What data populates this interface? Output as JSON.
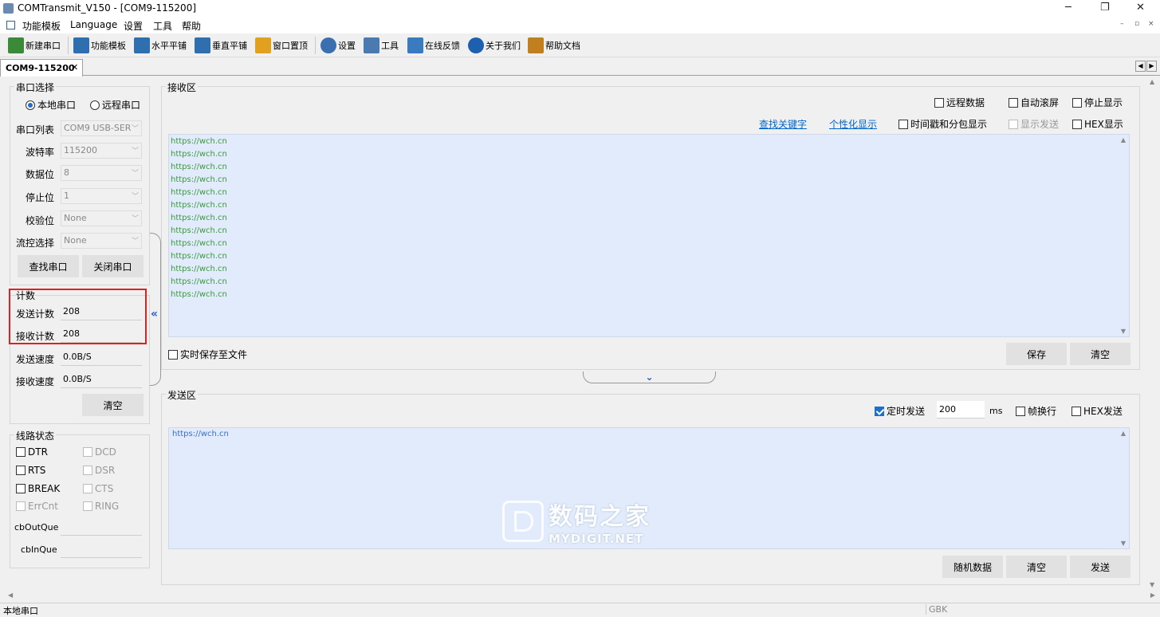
{
  "window": {
    "title": "COMTransmit_V150 - [COM9-115200]",
    "minimize": "─",
    "maximize": "❐",
    "close": "✕"
  },
  "menu": {
    "items": [
      "功能模板",
      "Language",
      "设置",
      "工具",
      "帮助"
    ]
  },
  "toolbar": {
    "buttons": [
      {
        "label": "新建串口",
        "icon": "new-port-icon",
        "color": "#3a8a3a"
      },
      {
        "label": "功能模板",
        "icon": "template-icon",
        "color": "#2f6fb0"
      },
      {
        "label": "水平平铺",
        "icon": "tile-horizontal-icon",
        "color": "#2f6fb0"
      },
      {
        "label": "垂直平铺",
        "icon": "tile-vertical-icon",
        "color": "#2f6fb0"
      },
      {
        "label": "窗口置顶",
        "icon": "pin-window-icon",
        "color": "#e0a020"
      },
      {
        "label": "设置",
        "icon": "gear-icon",
        "color": "#3a6fb0"
      },
      {
        "label": "工具",
        "icon": "tools-icon",
        "color": "#4a7ab0"
      },
      {
        "label": "在线反馈",
        "icon": "feedback-icon",
        "color": "#3a7ac0"
      },
      {
        "label": "关于我们",
        "icon": "info-icon",
        "color": "#1e5fb0"
      },
      {
        "label": "帮助文档",
        "icon": "help-doc-icon",
        "color": "#c08020"
      }
    ]
  },
  "tab": {
    "label": "COM9-115200",
    "close": "✕"
  },
  "port": {
    "section": "串口选择",
    "local": "本地串口",
    "remote": "远程串口",
    "list_label": "串口列表",
    "list_value": "COM9   USB-SER",
    "baud_label": "波特率",
    "baud_value": "115200",
    "data_label": "数据位",
    "data_value": "8",
    "stop_label": "停止位",
    "stop_value": "1",
    "parity_label": "校验位",
    "parity_value": "None",
    "flow_label": "流控选择",
    "flow_value": "None",
    "find_btn": "查找串口",
    "close_btn": "关闭串口"
  },
  "count": {
    "section": "计数",
    "send_label": "发送计数",
    "send_value": "208",
    "recv_label": "接收计数",
    "recv_value": "208",
    "send_speed_label": "发送速度",
    "send_speed_value": "0.0B/S",
    "recv_speed_label": "接收速度",
    "recv_speed_value": "0.0B/S",
    "clear_btn": "清空"
  },
  "line": {
    "section": "线路状态",
    "dtr": "DTR",
    "dcd": "DCD",
    "rts": "RTS",
    "dsr": "DSR",
    "brk": "BREAK",
    "cts": "CTS",
    "errcnt": "ErrCnt",
    "ring": "RING",
    "outq_label": "cbOutQue",
    "inq_label": "cbInQue"
  },
  "receive": {
    "section": "接收区",
    "remote_data": "远程数据",
    "auto_scroll": "自动滚屏",
    "stop_display": "停止显示",
    "find_keyword": "查找关键字",
    "custom_display": "个性化显示",
    "timestamp": "时间戳和分包显示",
    "show_send": "显示发送",
    "hex_display": "HEX显示",
    "lines": [
      "https://wch.cn",
      "https://wch.cn",
      "https://wch.cn",
      "https://wch.cn",
      "https://wch.cn",
      "https://wch.cn",
      "https://wch.cn",
      "https://wch.cn",
      "https://wch.cn",
      "https://wch.cn",
      "https://wch.cn",
      "https://wch.cn",
      "https://wch.cn"
    ],
    "save_file": "实时保存至文件",
    "save_btn": "保存",
    "clear_btn": "清空"
  },
  "send": {
    "section": "发送区",
    "timed_send": "定时发送",
    "interval": "200",
    "unit": "ms",
    "frame_newline": "帧换行",
    "hex_send": "HEX发送",
    "text": "https://wch.cn",
    "random_btn": "随机数据",
    "clear_btn": "清空",
    "send_btn": "发送"
  },
  "watermark": {
    "cn": "数码之家",
    "en": "MYDIGIT.NET"
  },
  "status": {
    "left": "本地串口",
    "encoding": "GBK"
  }
}
